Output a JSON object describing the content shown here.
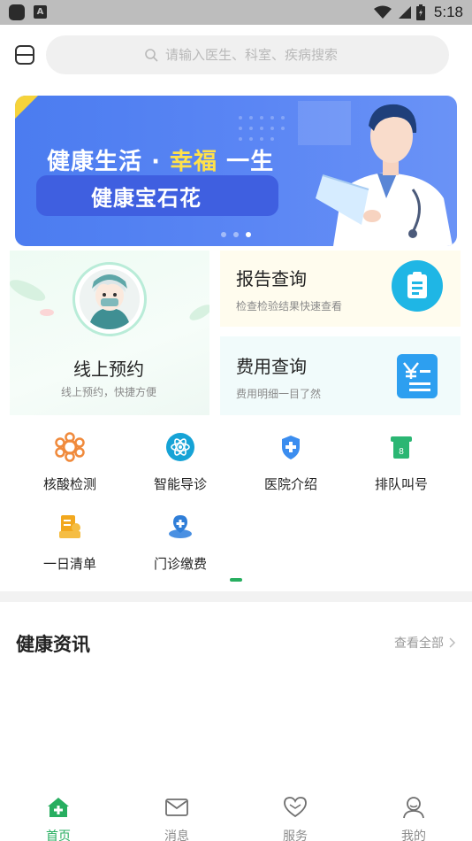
{
  "status_bar": {
    "time": "5:18",
    "notification_glyph": "A"
  },
  "header": {
    "search_placeholder": "请输入医生、科室、疾病搜索"
  },
  "banner": {
    "line1_white": "健康生活",
    "line1_sep": "·",
    "line1_yellow": "幸福",
    "line1_tail": "一生",
    "line2": "健康宝石花",
    "slide_count": 3,
    "active_slide": 3
  },
  "quick_cards": {
    "appointment": {
      "title": "线上预约",
      "subtitle": "线上预约，快捷方便"
    },
    "report": {
      "title": "报告查询",
      "subtitle": "检查检验结果快速查看"
    },
    "fee": {
      "title": "费用查询",
      "subtitle": "费用明细一目了然"
    }
  },
  "services": [
    {
      "label": "核酸检测",
      "icon": "nucleic-acid-icon"
    },
    {
      "label": "智能导诊",
      "icon": "atom-icon"
    },
    {
      "label": "医院介绍",
      "icon": "hospital-shield-icon"
    },
    {
      "label": "排队叫号",
      "icon": "queue-ticket-icon"
    },
    {
      "label": "一日清单",
      "icon": "daily-list-icon"
    },
    {
      "label": "门诊缴费",
      "icon": "outpatient-payment-icon"
    }
  ],
  "news": {
    "title": "健康资讯",
    "more": "查看全部"
  },
  "tabbar": [
    {
      "label": "首页",
      "icon": "home-icon",
      "active": true
    },
    {
      "label": "消息",
      "icon": "mail-icon",
      "active": false
    },
    {
      "label": "服务",
      "icon": "heart-icon",
      "active": false
    },
    {
      "label": "我的",
      "icon": "user-icon",
      "active": false
    }
  ],
  "colors": {
    "primary_green": "#27ae60",
    "banner_blue": "#5b86f4",
    "banner_yellow": "#ffe14a",
    "report_badge": "#1fb6e5",
    "fee_badge": "#2d9ff0"
  }
}
